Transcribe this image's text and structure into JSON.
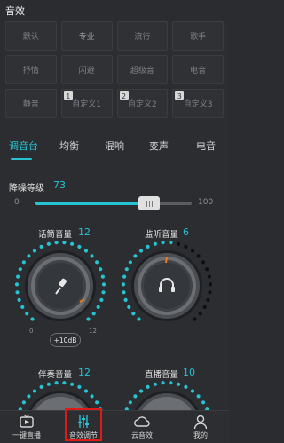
{
  "header": {
    "title": "音效"
  },
  "presets": [
    [
      {
        "label": "默认"
      },
      {
        "label": "专业"
      },
      {
        "label": "流行"
      },
      {
        "label": "歌手"
      }
    ],
    [
      {
        "label": "抒情"
      },
      {
        "label": "闪避"
      },
      {
        "label": "超级音"
      },
      {
        "label": "电音"
      }
    ],
    [
      {
        "label": "静音"
      },
      {
        "label": "自定义1",
        "num": "1"
      },
      {
        "label": "自定义2",
        "num": "2"
      },
      {
        "label": "自定义3",
        "num": "3"
      }
    ]
  ],
  "tabs": [
    {
      "label": "调音台"
    },
    {
      "label": "均衡"
    },
    {
      "label": "混响"
    },
    {
      "label": "变声"
    },
    {
      "label": "电音"
    }
  ],
  "noise_reduction": {
    "label": "降噪等级",
    "value": "73",
    "min": "0",
    "max": "100",
    "fraction": 0.73
  },
  "knobs": {
    "mic_volume": {
      "title": "话筒音量",
      "value": "12",
      "min": "0",
      "max": "12",
      "boost_label": "+10dB"
    },
    "monitor_volume": {
      "title": "监听音量",
      "value": "6"
    },
    "accompany_volume": {
      "title": "伴奏音量",
      "value": "12"
    },
    "live_volume": {
      "title": "直播音量",
      "value": "10"
    }
  },
  "bottom_nav": [
    {
      "label": "一键直播",
      "icon": "live-tv-icon"
    },
    {
      "label": "音效调节",
      "icon": "equalizer-icon"
    },
    {
      "label": "云音效",
      "icon": "cloud-icon"
    },
    {
      "label": "我的",
      "icon": "person-icon"
    }
  ],
  "colors": {
    "accent": "#26c3d3",
    "highlight_box": "#e01919",
    "orange_marker": "#f07a1c"
  }
}
